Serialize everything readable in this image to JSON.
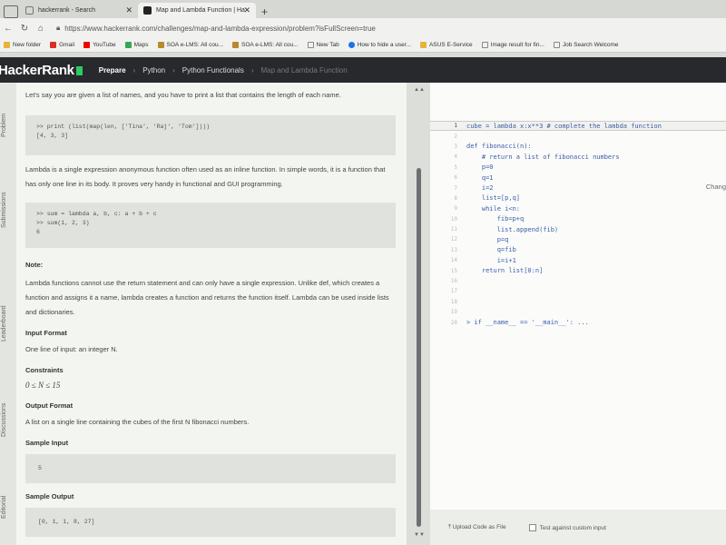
{
  "browser": {
    "tabs": [
      {
        "label": "hackerrank - Search",
        "active": false
      },
      {
        "label": "Map and Lambda Function | Ha",
        "active": true
      }
    ],
    "url": "https://www.hackerrank.com/challenges/map-and-lambda-expression/problem?isFullScreen=true",
    "bookmarks": [
      "New folder",
      "Gmail",
      "YouTube",
      "Maps",
      "SOA e-LMS: All cou...",
      "SOA e-LMS: All cou...",
      "New Tab",
      "How to hide a user...",
      "ASUS E-Service",
      "Image result for fin...",
      "Job Search Welcome"
    ]
  },
  "site": {
    "logo": "HackerRank",
    "crumbs": [
      "Prepare",
      "Python",
      "Python Functionals",
      "Map and Lambda Function"
    ]
  },
  "rail": [
    "Problem",
    "Submissions",
    "Leaderboard",
    "Discussions",
    "Editorial"
  ],
  "problem": {
    "intro": "Let's say you are given a list of names, and you have to print a list that contains the length of each name.",
    "code1": ">> print (list(map(len, ['Tina', 'Raj', 'Tom'])))\n[4, 3, 3]",
    "lambda_desc": "Lambda is a single expression anonymous function often used as an inline function. In simple words, it is a function that has only one line in its body. It proves very handy in functional and GUI programming.",
    "code2": ">> sum = lambda a, b, c: a + b + c\n>> sum(1, 2, 3)\n6",
    "note_label": "Note:",
    "note": "Lambda functions cannot use the return statement and can only have a single expression. Unlike def, which creates a function and assigns it a name, lambda creates a function and returns the function itself. Lambda can be used inside lists and dictionaries.",
    "input_format_label": "Input Format",
    "input_format": "One line of input: an integer N.",
    "constraints_label": "Constraints",
    "constraints": "0 ≤ N ≤ 15",
    "output_format_label": "Output Format",
    "output_format": "A list on a single line containing the cubes of the first N fibonacci numbers.",
    "sample_input_label": "Sample Input",
    "sample_input": "5",
    "sample_output_label": "Sample Output",
    "sample_output": "[0, 1, 1, 8, 27]"
  },
  "editor": {
    "change_label": "Chang",
    "lines": [
      "cube = lambda x:x**3 # complete the lambda function",
      "",
      "def fibonacci(n):",
      "    # return a list of fibonacci numbers",
      "    p=0",
      "    q=1",
      "    i=2",
      "    list=[p,q]",
      "    while i<n:",
      "        fib=p+q",
      "        list.append(fib)",
      "        p=q",
      "        q=fib",
      "        i=i+1",
      "    return list[0:n]",
      "",
      "",
      "",
      "",
      "> if __name__ == '__main__': ..."
    ],
    "line_numbers": [
      "1",
      "2",
      "3",
      "4",
      "5",
      "6",
      "7",
      "8",
      "9",
      "10",
      "11",
      "12",
      "13",
      "14",
      "15",
      "16",
      "17",
      "18",
      "19",
      "20"
    ],
    "upload_label": "Upload Code as File",
    "custom_input_label": "Test against custom input"
  }
}
